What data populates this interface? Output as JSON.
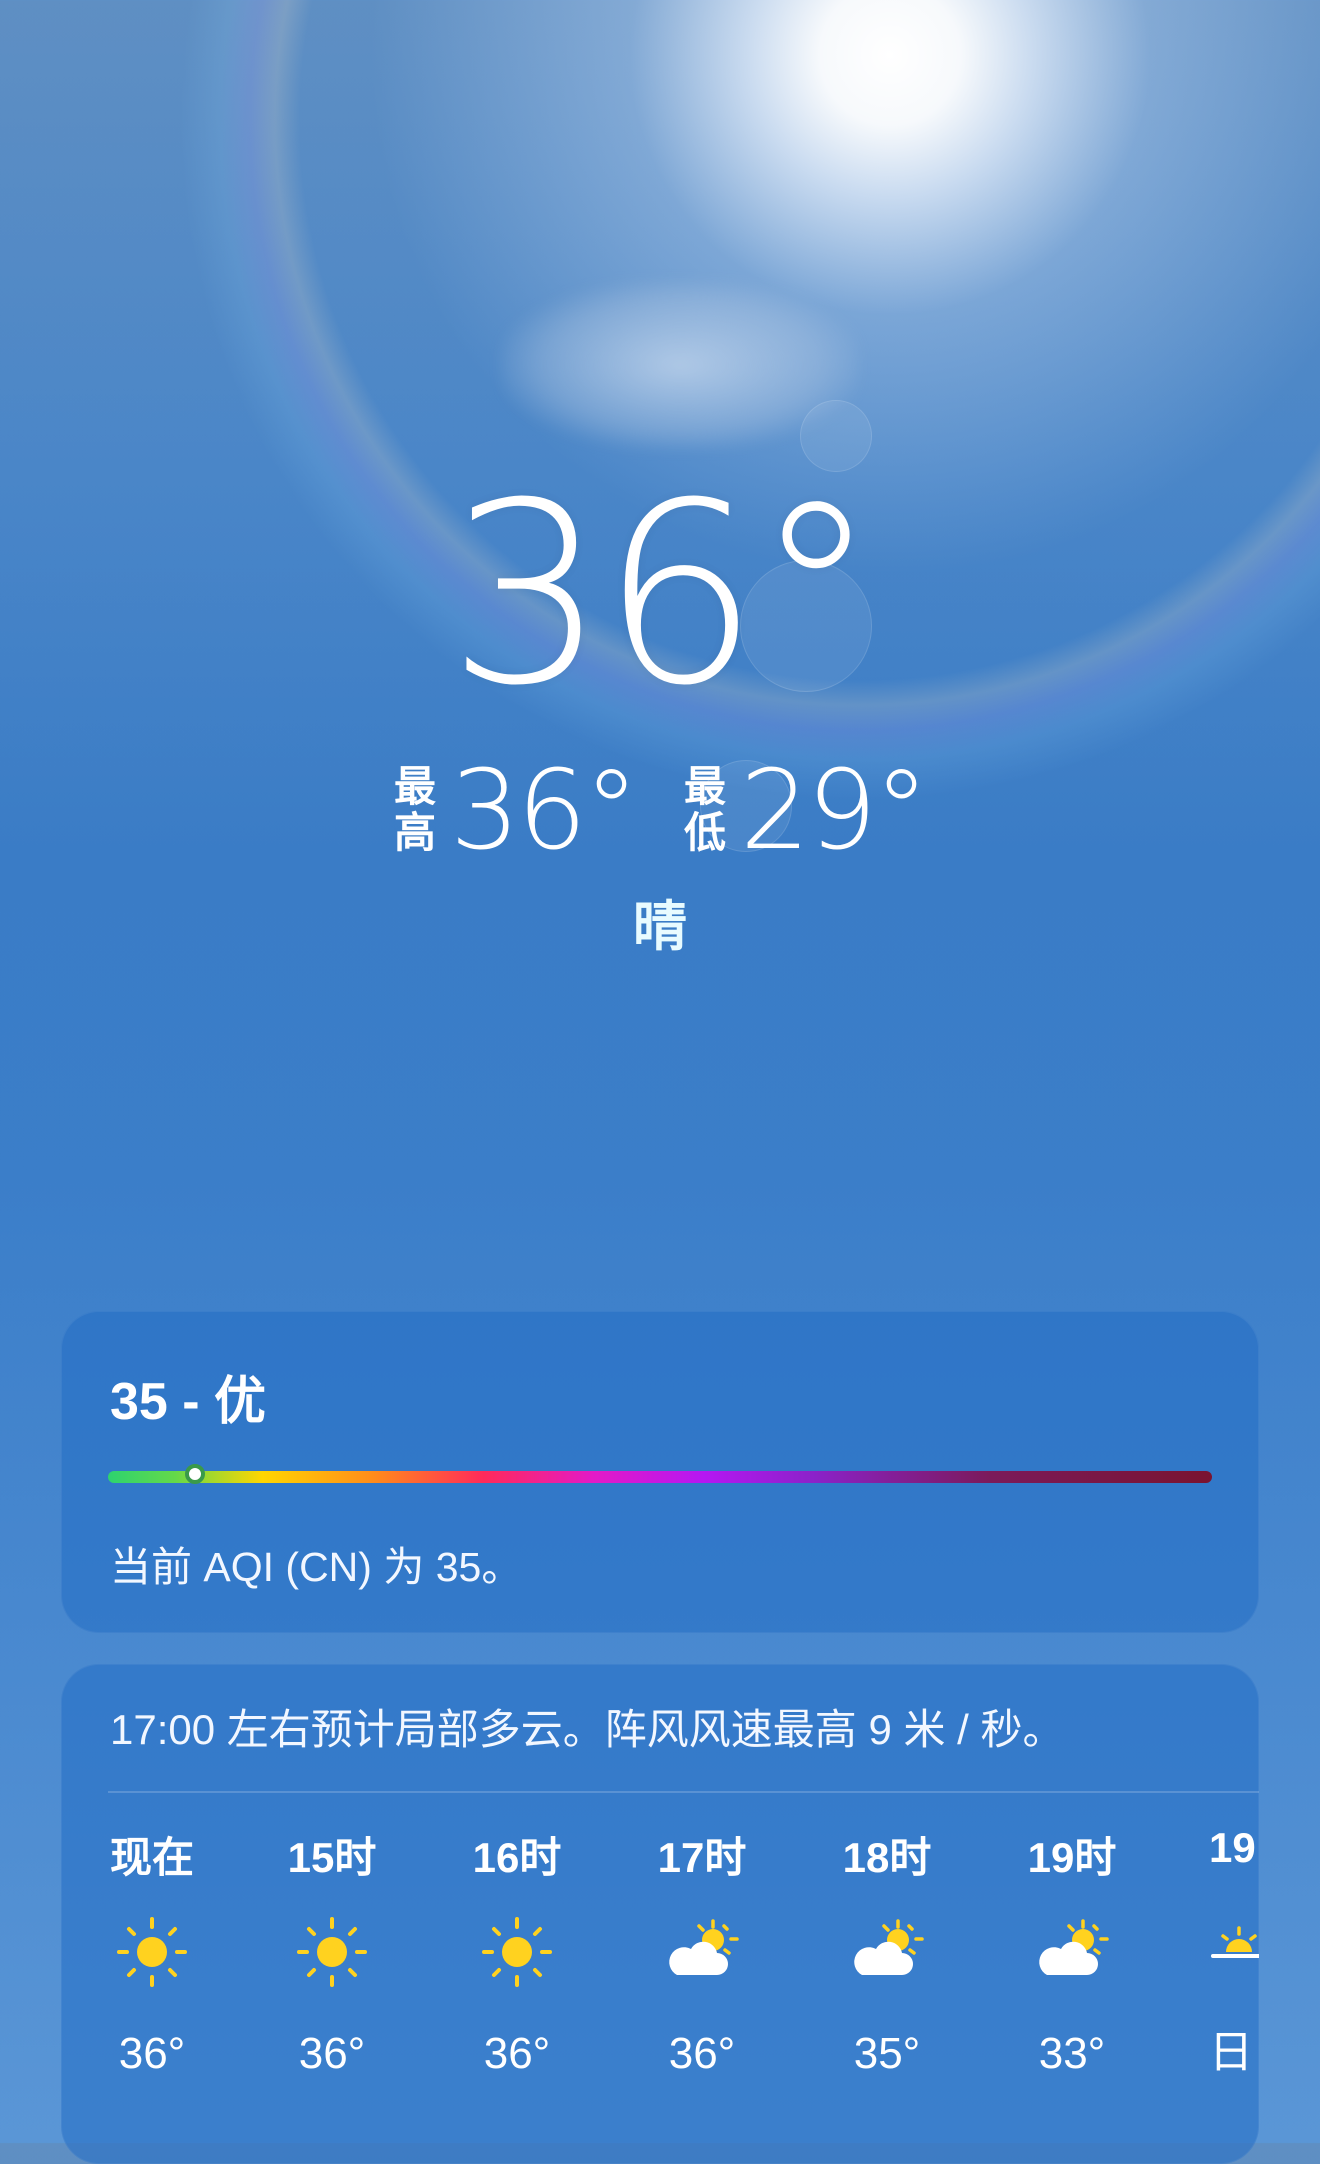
{
  "current": {
    "temperature": "36°",
    "high_label": [
      "最",
      "高"
    ],
    "high_value": "36°",
    "low_label": [
      "最",
      "低"
    ],
    "low_value": "29°",
    "condition": "晴"
  },
  "aqi": {
    "title": "35 - 优",
    "value": 35,
    "scale_position": 0.075,
    "description": "当前 AQI (CN) 为 35。"
  },
  "hourly": {
    "summary": "17:00 左右预计局部多云。阵风风速最高 9 米 / 秒。",
    "items": [
      {
        "label": "现在",
        "icon": "sun-icon",
        "temp": "36°"
      },
      {
        "label": "15时",
        "icon": "sun-icon",
        "temp": "36°"
      },
      {
        "label": "16时",
        "icon": "sun-icon",
        "temp": "36°"
      },
      {
        "label": "17时",
        "icon": "partly-cloudy-icon",
        "temp": "36°"
      },
      {
        "label": "18时",
        "icon": "partly-cloudy-icon",
        "temp": "35°"
      },
      {
        "label": "19时",
        "icon": "partly-cloudy-icon",
        "temp": "33°"
      }
    ],
    "partial": {
      "label": "19",
      "icon": "sunset-icon",
      "temp": "日"
    }
  },
  "colors": {
    "sun": "#ffd21f",
    "cloud": "#ffffff"
  }
}
